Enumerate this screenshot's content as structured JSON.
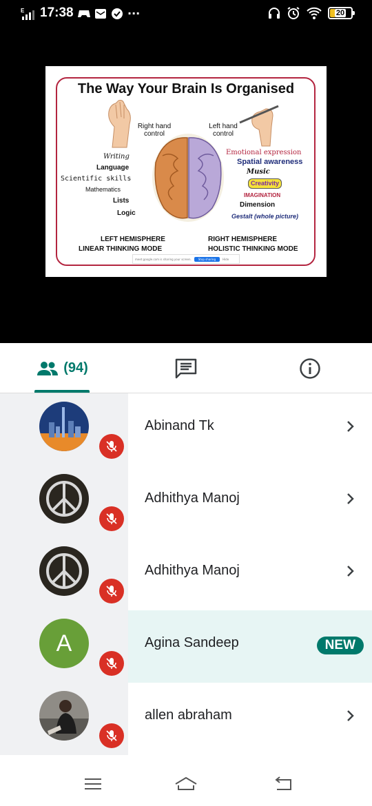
{
  "status_bar": {
    "network": "E",
    "time": "17:38",
    "battery": "20",
    "more": "···",
    "colors": {
      "battery_fill": "#f0c020"
    }
  },
  "slide": {
    "title": "The Way Your Brain Is Organised",
    "right_hand_control": "Right hand control",
    "left_hand_control": "Left hand control",
    "left_items": [
      "Writing",
      "Language",
      "Scientific skills",
      "Mathematics",
      "Lists",
      "Logic"
    ],
    "right_items": [
      "Emotional expression",
      "Spatial awareness",
      "Music",
      "Creativity",
      "IMAGINATION",
      "Dimension",
      "Gestalt (whole picture)"
    ],
    "left_hemisphere": "LEFT HEMISPHERE",
    "left_mode": "LINEAR THINKING MODE",
    "right_hemisphere": "RIGHT HEMISPHERE",
    "right_mode": "HOLISTIC THINKING MODE",
    "share_text": "meet.google.com is sharing your screen.",
    "stop_sharing": "Stop sharing",
    "hide": "Hide"
  },
  "tabs": {
    "people_count": "(94)",
    "active": "people",
    "accent_color": "#00796b"
  },
  "participants": [
    {
      "name": "Abinand Tk",
      "avatar": "city-night-photo",
      "muted": true,
      "badge": null
    },
    {
      "name": "Adhithya Manoj",
      "avatar": "peace-sign-photo",
      "muted": true,
      "badge": null
    },
    {
      "name": "Adhithya Manoj",
      "avatar": "peace-sign-photo",
      "muted": true,
      "badge": null
    },
    {
      "name": "Agina Sandeep",
      "avatar": "letter",
      "avatar_letter": "A",
      "avatar_color": "#689f38",
      "muted": true,
      "badge": "NEW"
    },
    {
      "name": "allen abraham",
      "avatar": "person-photo",
      "muted": true,
      "badge": null
    }
  ],
  "colors": {
    "mute_red": "#d93025",
    "highlight_row": "#e7f5f4",
    "slide_border": "#b3243f"
  }
}
